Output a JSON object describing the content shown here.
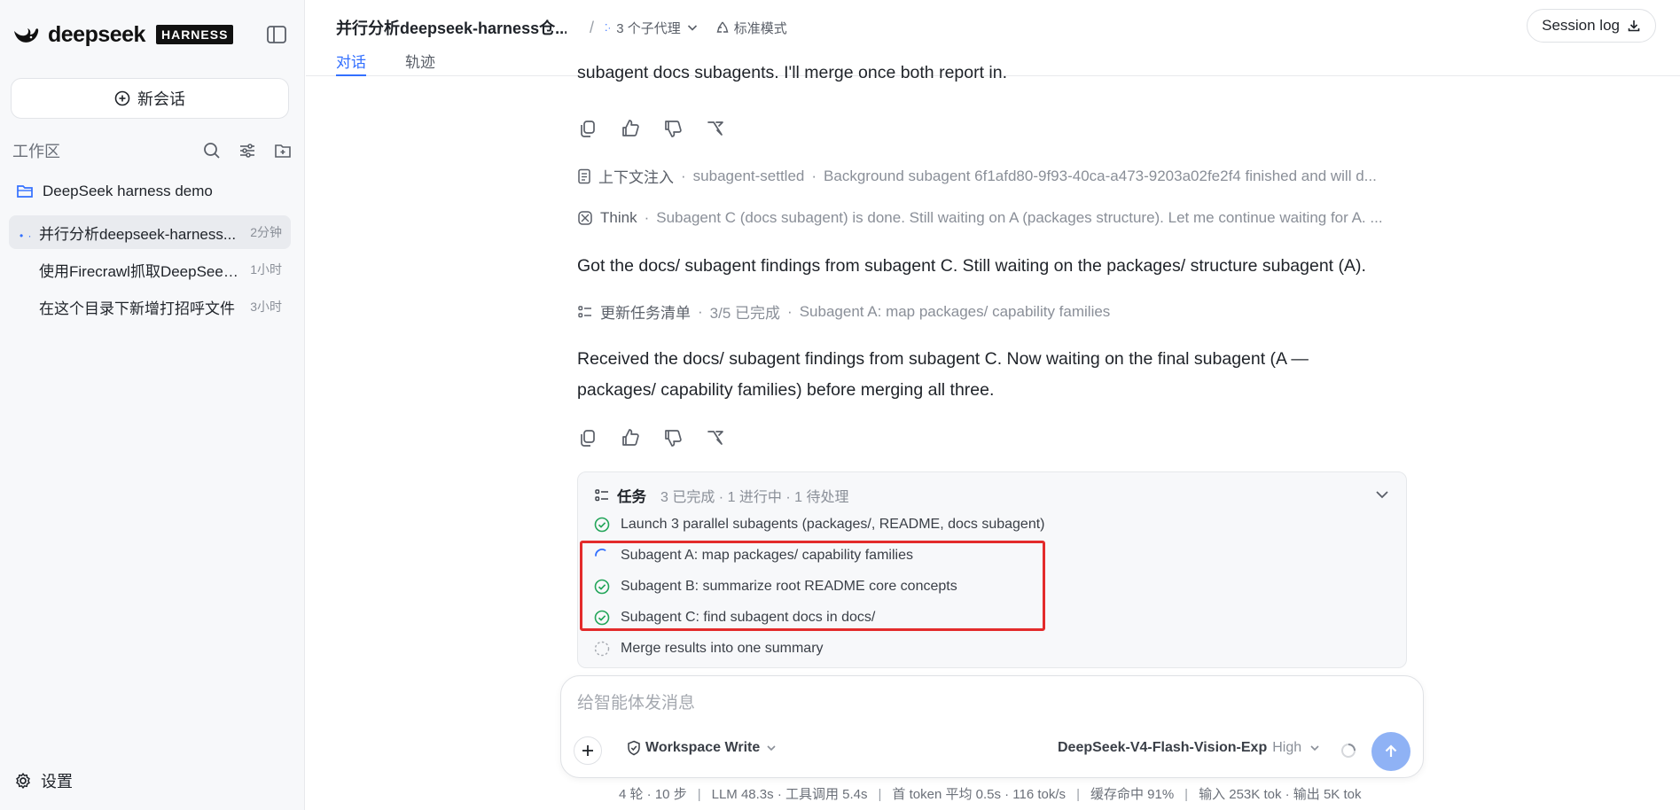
{
  "brand": {
    "name": "deepseek",
    "badge": "HARNESS"
  },
  "sidebar": {
    "new_chat_label": "新会话",
    "workspace_title": "工作区",
    "project": "DeepSeek harness demo",
    "sessions": [
      {
        "title": "并行分析deepseek-harness...",
        "time": "2分钟",
        "active": true
      },
      {
        "title": "使用Firecrawl抓取DeepSeek...",
        "time": "1小时",
        "active": false
      },
      {
        "title": "在这个目录下新增打招呼文件",
        "time": "3小时",
        "active": false
      }
    ],
    "settings_label": "设置"
  },
  "header": {
    "chat_title": "并行分析deepseek-harness仓...",
    "separator": "/",
    "subagents_label": "3 个子代理",
    "mode_label": "标准模式",
    "tabs": [
      {
        "label": "对话",
        "active": true
      },
      {
        "label": "轨迹",
        "active": false
      }
    ],
    "session_log_label": "Session log"
  },
  "conversation": {
    "partial_top_text": "subagent docs subagents. I'll merge once both report in.",
    "context_inject": {
      "label": "上下文注入",
      "tag": "subagent-settled",
      "text": "Background subagent 6f1afd80-9f93-40ca-a473-9203a02fe2f4 finished and will d..."
    },
    "think": {
      "label": "Think",
      "text": "Subagent C (docs subagent) is done. Still waiting on A (packages structure). Let me continue waiting for A. ..."
    },
    "message_1": "Got the docs/ subagent findings from subagent C. Still waiting on the packages/ structure subagent (A).",
    "task_update": {
      "label": "更新任务清单",
      "progress": "3/5 已完成",
      "current": "Subagent A: map packages/ capability families"
    },
    "message_2_line1": "Received the docs/ subagent findings from subagent C. Now waiting on the final subagent (A —",
    "message_2_line2": "packages/ capability families) before merging all three."
  },
  "tasks": {
    "title": "任务",
    "done": "3 已完成",
    "in_progress": "1 进行中",
    "pending": "1 待处理",
    "items": [
      {
        "label": "Launch 3 parallel subagents (packages/, README, docs subagent)",
        "status": "done"
      },
      {
        "label": "Subagent A: map packages/ capability families",
        "status": "running"
      },
      {
        "label": "Subagent B: summarize root README core concepts",
        "status": "done"
      },
      {
        "label": "Subagent C: find subagent docs in docs/",
        "status": "done"
      },
      {
        "label": "Merge results into one summary",
        "status": "pending"
      }
    ]
  },
  "composer": {
    "placeholder": "给智能体发消息",
    "permission_label": "Workspace Write",
    "model_name": "DeepSeek-V4-Flash-Vision-Exp",
    "model_level": "High"
  },
  "statusbar": {
    "turns": "4 轮 · 10 步",
    "llm": "LLM 48.3s · 工具调用 5.4s",
    "first_token": "首 token 平均 0.5s · 116 tok/s",
    "cache": "缓存命中 91%",
    "io": "输入 253K tok · 输出 5K tok"
  },
  "colors": {
    "accent": "#3370ff",
    "done": "#22a559",
    "highlight": "#e32b2b"
  }
}
